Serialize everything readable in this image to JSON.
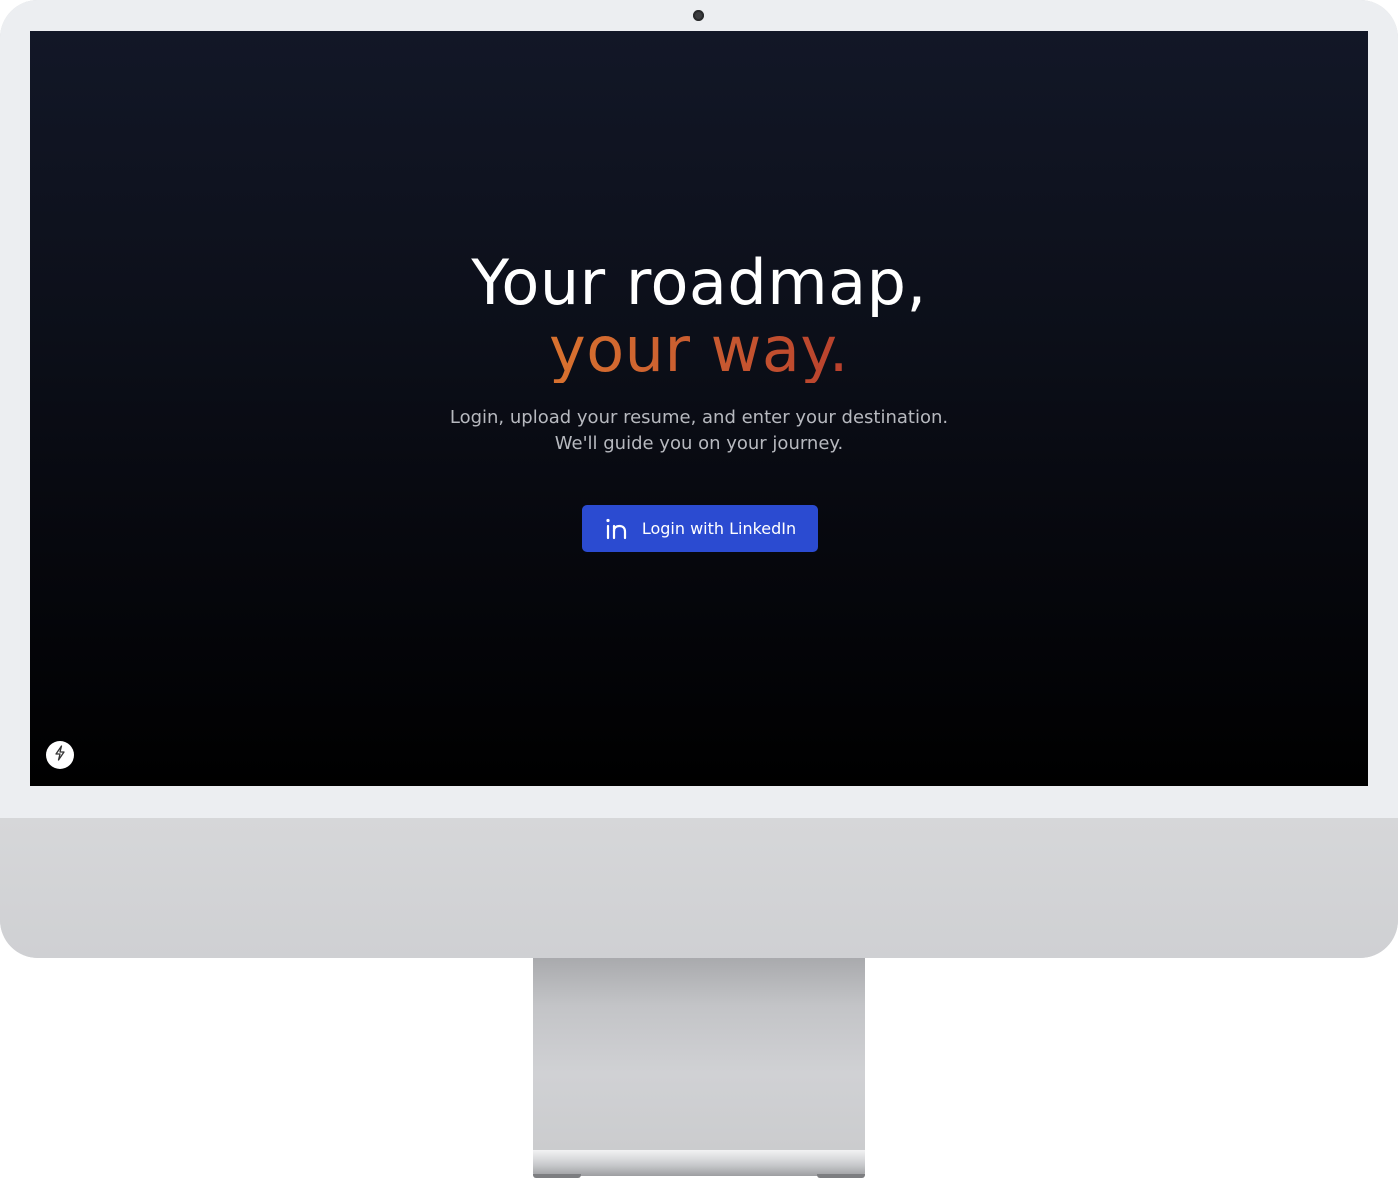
{
  "hero": {
    "headline": "Your roadmap,",
    "headline_accent": "your way.",
    "subtitle_line1": "Login, upload your resume, and enter your destination.",
    "subtitle_line2": "We'll guide you on your journey."
  },
  "login_button": {
    "label": "Login with LinkedIn",
    "icon": "linkedin-icon"
  },
  "corner_badge": {
    "icon": "lightning-bolt-icon"
  },
  "colors": {
    "accent_gradient_start": "#d9722f",
    "accent_gradient_end": "#b8402d",
    "button_background": "#2b4bd1",
    "screen_background_top": "#121727",
    "screen_background_bottom": "#000000"
  }
}
